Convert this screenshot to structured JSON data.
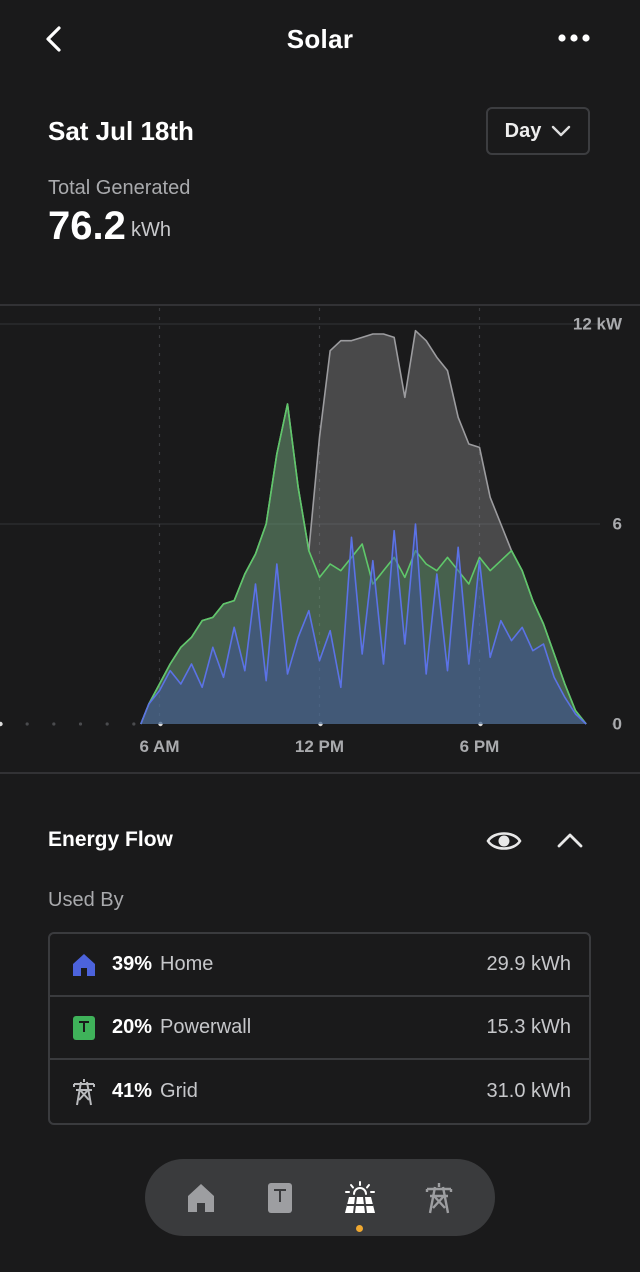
{
  "header": {
    "title": "Solar"
  },
  "summary": {
    "date": "Sat Jul 18th",
    "range_selected": "Day",
    "total_label": "Total Generated",
    "total_value": "76.2",
    "total_unit": "kWh"
  },
  "chart_data": {
    "type": "area",
    "x_tick_labels": [
      "6 AM",
      "12 PM",
      "6 PM"
    ],
    "y_tick_labels": [
      "12 kW",
      "6",
      "0"
    ],
    "ylim": [
      0,
      12
    ],
    "xlim": [
      0,
      24
    ],
    "grid": true,
    "colors": {
      "total": "#9c9c9f",
      "powerwall": "#5fc86a",
      "home": "#5b72e6"
    },
    "series": [
      {
        "x": [
          5.3,
          5.6,
          6.0,
          6.4,
          6.8,
          7.2,
          7.6,
          8.0,
          8.4,
          8.8,
          9.2,
          9.6,
          10.0,
          10.4,
          10.8,
          11.2,
          11.6,
          12.0,
          12.4,
          12.8,
          13.2,
          13.6,
          14.0,
          14.4,
          14.8,
          15.2,
          15.6,
          16.0,
          16.4,
          16.8,
          17.2,
          17.6,
          18.0,
          18.4,
          18.8,
          19.2,
          19.6,
          20.0,
          20.4,
          20.8,
          21.2,
          21.6,
          22.0
        ],
        "values": [
          0,
          0.6,
          1.2,
          1.8,
          2.3,
          2.6,
          3.1,
          3.2,
          3.6,
          3.7,
          4.5,
          5.1,
          6.0,
          8.1,
          9.6,
          7.1,
          5.2,
          8.6,
          11.2,
          11.5,
          11.5,
          11.6,
          11.7,
          11.7,
          11.6,
          9.8,
          11.8,
          11.5,
          11.0,
          10.6,
          9.2,
          8.4,
          8.3,
          6.8,
          6.0,
          5.2,
          4.6,
          3.7,
          3.0,
          2.1,
          1.2,
          0.4,
          0
        ]
      },
      {
        "x": [
          5.3,
          5.6,
          6.0,
          6.4,
          6.8,
          7.2,
          7.6,
          8.0,
          8.4,
          8.8,
          9.2,
          9.6,
          10.0,
          10.4,
          10.8,
          11.2,
          11.6,
          12.0,
          12.4,
          12.8,
          13.2,
          13.6,
          14.0,
          14.4,
          14.8,
          15.2,
          15.6,
          16.0,
          16.4,
          16.8,
          17.2,
          17.6,
          18.0,
          18.4,
          18.8,
          19.2,
          19.6,
          20.0,
          20.4,
          20.8,
          21.2,
          21.6,
          22.0
        ],
        "values": [
          0,
          0.6,
          1.2,
          1.8,
          2.3,
          2.6,
          3.1,
          3.2,
          3.6,
          3.7,
          4.5,
          5.1,
          6.0,
          8.1,
          9.6,
          7.1,
          5.2,
          4.4,
          4.8,
          4.6,
          5.0,
          5.4,
          4.2,
          4.6,
          5.0,
          4.4,
          5.2,
          4.8,
          4.6,
          5.0,
          4.6,
          4.2,
          5.0,
          4.6,
          4.9,
          5.2,
          4.6,
          3.7,
          3.0,
          2.1,
          1.2,
          0.4,
          0
        ]
      },
      {
        "x": [
          5.3,
          5.6,
          6.0,
          6.4,
          6.8,
          7.2,
          7.6,
          8.0,
          8.4,
          8.8,
          9.2,
          9.6,
          10.0,
          10.4,
          10.8,
          11.2,
          11.6,
          12.0,
          12.4,
          12.8,
          13.2,
          13.6,
          14.0,
          14.4,
          14.8,
          15.2,
          15.6,
          16.0,
          16.4,
          16.8,
          17.2,
          17.6,
          18.0,
          18.4,
          18.8,
          19.2,
          19.6,
          20.0,
          20.4,
          20.8,
          21.2,
          21.6,
          22.0
        ],
        "values": [
          0,
          0.6,
          1.0,
          1.6,
          1.2,
          1.8,
          1.1,
          2.3,
          1.4,
          2.9,
          1.6,
          4.2,
          1.3,
          4.8,
          1.5,
          2.6,
          3.4,
          1.9,
          2.8,
          1.1,
          5.6,
          2.1,
          4.9,
          1.8,
          5.8,
          2.4,
          6.0,
          1.5,
          4.5,
          1.6,
          5.3,
          1.8,
          4.9,
          2.0,
          3.1,
          2.5,
          2.9,
          2.2,
          2.4,
          1.4,
          0.8,
          0.3,
          0
        ]
      }
    ]
  },
  "energy_flow": {
    "title": "Energy Flow",
    "used_by_label": "Used By",
    "rows": [
      {
        "percent": "39%",
        "name": "Home",
        "kwh": "29.9 kWh"
      },
      {
        "percent": "20%",
        "name": "Powerwall",
        "kwh": "15.3 kWh"
      },
      {
        "percent": "41%",
        "name": "Grid",
        "kwh": "31.0 kWh"
      }
    ]
  },
  "tabbar": {
    "items": [
      "home-icon",
      "powerwall-icon",
      "solar-icon",
      "grid-icon"
    ],
    "active": 2,
    "accent": "#f0a830"
  }
}
